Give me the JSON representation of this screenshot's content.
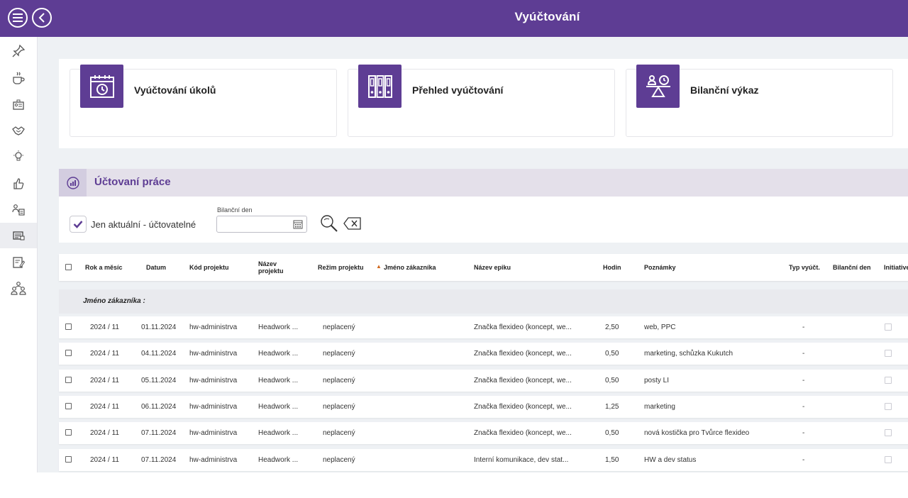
{
  "header": {
    "title": "Vyúčtování"
  },
  "colors": {
    "brand": "#5e3d94",
    "section_bg": "#e4e0ea",
    "main_bg": "#eef1f4"
  },
  "sidebar": {
    "items": [
      {
        "icon": "pin-icon"
      },
      {
        "icon": "coffee-cup-icon"
      },
      {
        "icon": "id-card-icon"
      },
      {
        "icon": "handshake-icon"
      },
      {
        "icon": "lightbulb-icon"
      },
      {
        "icon": "thumbs-up-icon"
      },
      {
        "icon": "team-icon"
      },
      {
        "icon": "billing-icon",
        "active": true
      },
      {
        "icon": "report-edit-icon"
      },
      {
        "icon": "organization-icon"
      }
    ]
  },
  "cards": [
    {
      "label": "Vyúčtování úkolů",
      "icon": "calendar-clock-icon"
    },
    {
      "label": "Přehled vyúčtování",
      "icon": "binders-icon"
    },
    {
      "label": "Bilanční výkaz",
      "icon": "balance-scale-icon"
    }
  ],
  "section": {
    "title": "Účtovaní práce",
    "icon": "work-history-icon"
  },
  "filters": {
    "only_current_label": "Jen aktuální - účtovatelné",
    "only_current_checked": true,
    "balance_day_label": "Bilanční den",
    "balance_day_value": ""
  },
  "table": {
    "columns": {
      "year_month": "Rok a měsíc",
      "date": "Datum",
      "project_code": "Kód projektu",
      "project_name_1": "Název",
      "project_name_2": "projektu",
      "project_mode": "Režim projektu",
      "customer": "Jméno zákazníka",
      "epic": "Název epiku",
      "hours": "Hodin",
      "notes": "Poznámky",
      "billing_type": "Typ vyúčt.",
      "balance_day": "Bilanční den",
      "initiative": "Initiative"
    },
    "group_label": "Jméno zákazníka :",
    "rows": [
      {
        "ym": "2024 / 11",
        "date": "01.11.2024",
        "code": "hw-administrva",
        "name": "Headwork ...",
        "mode": "neplacený",
        "customer": "",
        "epic": "Značka flexideo (koncept, we...",
        "hours": "2,50",
        "notes": "web, PPC",
        "type": "-"
      },
      {
        "ym": "2024 / 11",
        "date": "04.11.2024",
        "code": "hw-administrva",
        "name": "Headwork ...",
        "mode": "neplacený",
        "customer": "",
        "epic": "Značka flexideo (koncept, we...",
        "hours": "0,50",
        "notes": "marketing, schůzka Kukutch",
        "type": "-"
      },
      {
        "ym": "2024 / 11",
        "date": "05.11.2024",
        "code": "hw-administrva",
        "name": "Headwork ...",
        "mode": "neplacený",
        "customer": "",
        "epic": "Značka flexideo (koncept, we...",
        "hours": "0,50",
        "notes": "posty LI",
        "type": "-"
      },
      {
        "ym": "2024 / 11",
        "date": "06.11.2024",
        "code": "hw-administrva",
        "name": "Headwork ...",
        "mode": "neplacený",
        "customer": "",
        "epic": "Značka flexideo (koncept, we...",
        "hours": "1,25",
        "notes": "marketing",
        "type": "-"
      },
      {
        "ym": "2024 / 11",
        "date": "07.11.2024",
        "code": "hw-administrva",
        "name": "Headwork ...",
        "mode": "neplacený",
        "customer": "",
        "epic": "Značka flexideo (koncept, we...",
        "hours": "0,50",
        "notes": "nová kostička pro Tvůrce flexideo",
        "type": "-"
      },
      {
        "ym": "2024 / 11",
        "date": "07.11.2024",
        "code": "hw-administrva",
        "name": "Headwork ...",
        "mode": "neplacený",
        "customer": "",
        "epic": "Interní komunikace, dev stat...",
        "hours": "1,50",
        "notes": "HW a dev status",
        "type": "-"
      }
    ]
  }
}
